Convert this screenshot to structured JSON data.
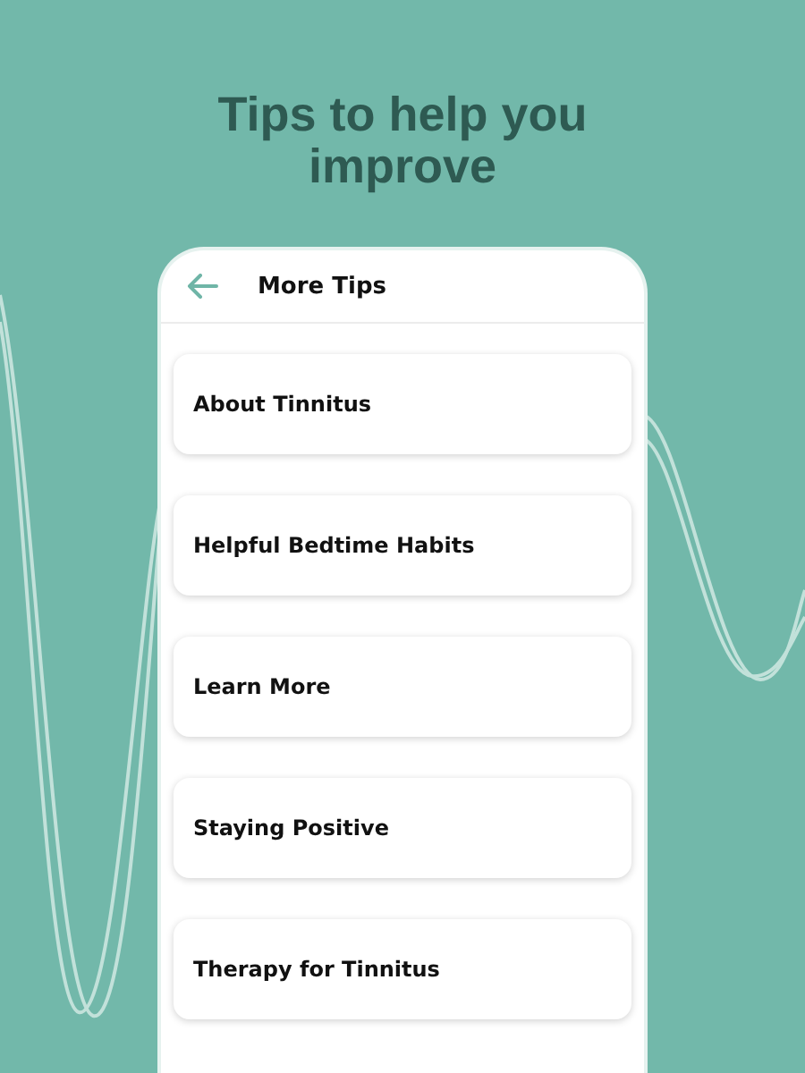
{
  "headline": "Tips to help you improve",
  "screen": {
    "title": "More Tips",
    "items": [
      {
        "label": "About Tinnitus"
      },
      {
        "label": "Helpful Bedtime Habits"
      },
      {
        "label": "Learn More"
      },
      {
        "label": "Staying Positive"
      },
      {
        "label": "Therapy for Tinnitus"
      }
    ]
  }
}
